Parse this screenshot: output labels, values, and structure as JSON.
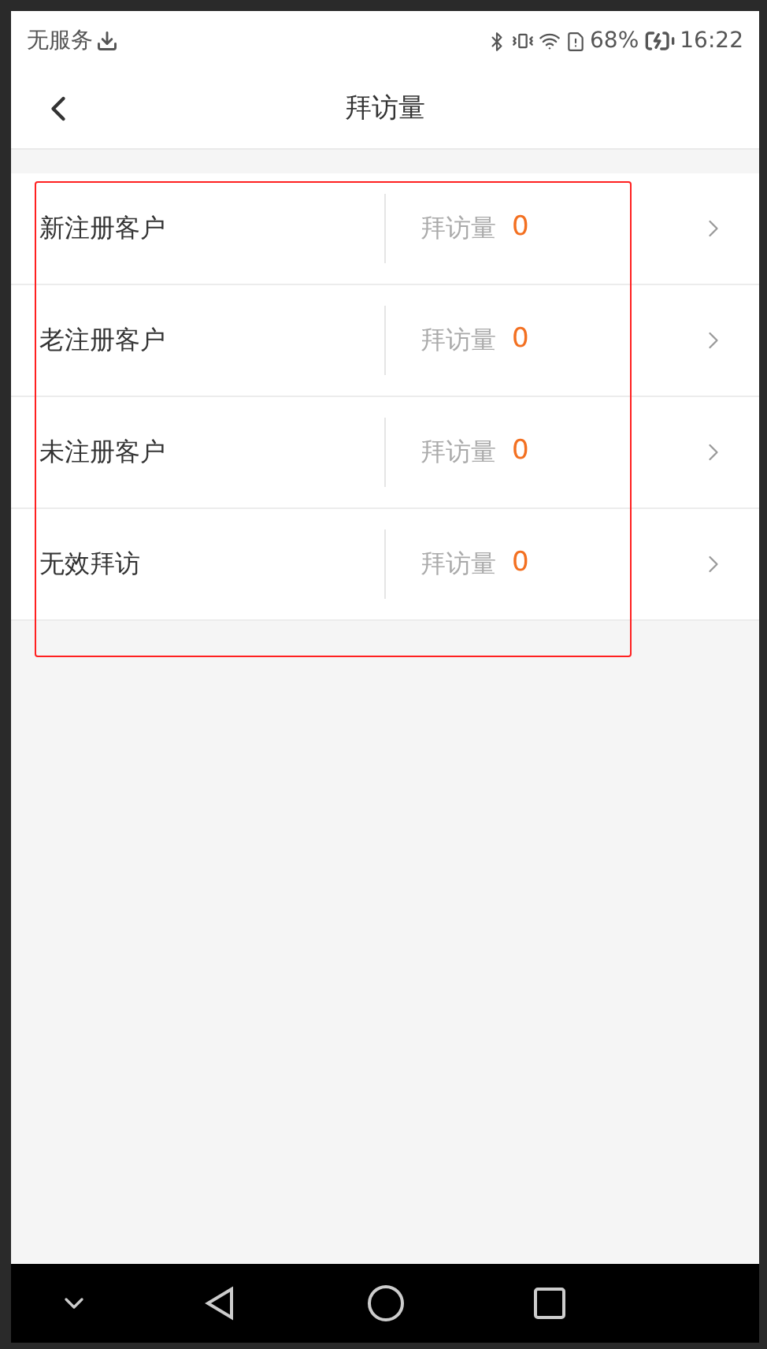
{
  "status_bar": {
    "carrier": "无服务",
    "battery": "68%",
    "time": "16:22"
  },
  "header": {
    "title": "拜访量"
  },
  "rows": [
    {
      "name": "新注册客户",
      "metric_label": "拜访量",
      "value": "0"
    },
    {
      "name": "老注册客户",
      "metric_label": "拜访量",
      "value": "0"
    },
    {
      "name": "未注册客户",
      "metric_label": "拜访量",
      "value": "0"
    },
    {
      "name": "无效拜访",
      "metric_label": "拜访量",
      "value": "0"
    }
  ]
}
